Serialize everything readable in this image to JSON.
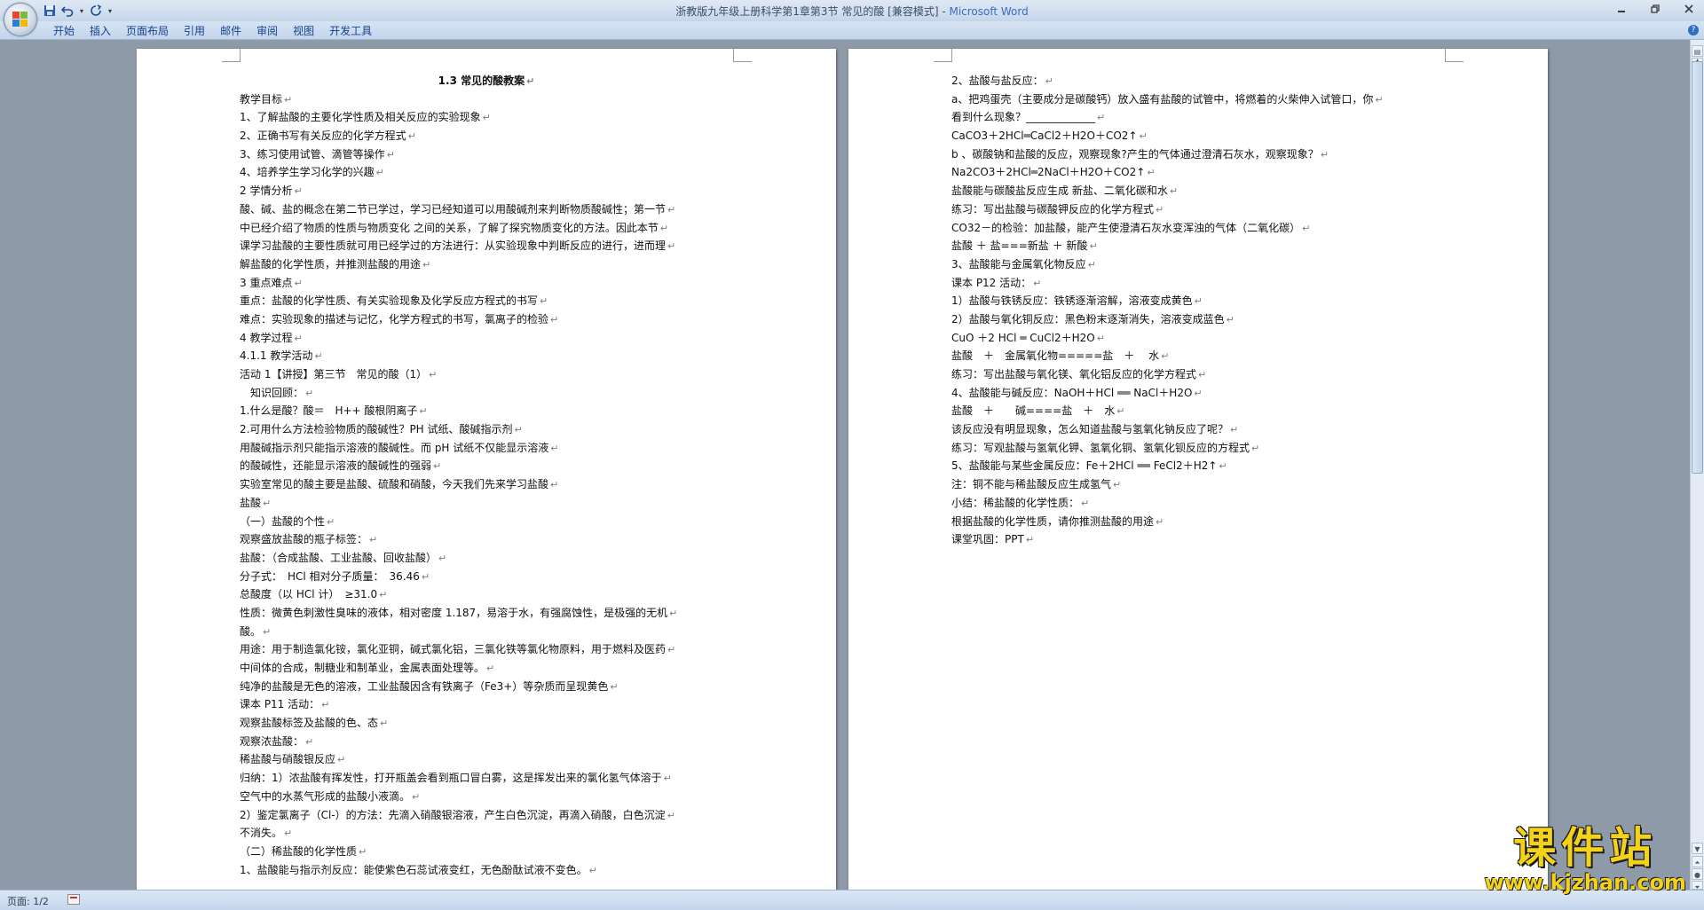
{
  "window": {
    "title_doc": "浙教版九年级上册科学第1章第3节 常见的酸 [兼容模式] - ",
    "title_app": "Microsoft Word"
  },
  "qat": {
    "more": "▾"
  },
  "ribbon": {
    "tabs": [
      "开始",
      "插入",
      "页面布局",
      "引用",
      "邮件",
      "审阅",
      "视图",
      "开发工具"
    ]
  },
  "page1": {
    "lines": [
      "1.3 常见的酸教案",
      "教学目标",
      "1、了解盐酸的主要化学性质及相关反应的实验现象",
      "2、正确书写有关反应的化学方程式",
      "3、练习使用试管、滴管等操作",
      "4、培养学生学习化学的兴趣",
      "2 学情分析",
      "酸、碱、盐的概念在第二节已学过，学习已经知道可以用酸碱剂来判断物质酸碱性；第一节",
      "中已经介绍了物质的性质与物质变化 之间的关系，了解了探究物质变化的方法。因此本节",
      "课学习盐酸的主要性质就可用已经学过的方法进行：从实验现象中判断反应的进行，进而理",
      "解盐酸的化学性质，并推测盐酸的用途",
      "3 重点难点",
      "重点：盐酸的化学性质、有关实验现象及化学反应方程式的书写",
      "难点：实验现象的描述与记忆，化学方程式的书写，氯离子的检验",
      "4 教学过程",
      "4.1.1 教学活动",
      "活动 1【讲授】第三节　常见的酸（1）",
      "　知识回顾：",
      "1.什么是酸？酸＝　H++ 酸根阴离子",
      "2.可用什么方法检验物质的酸碱性？PH 试纸、酸碱指示剂",
      "用酸碱指示剂只能指示溶液的酸碱性。而 pH 试纸不仅能显示溶液",
      "的酸碱性，还能显示溶液的酸碱性的强弱",
      "实验室常见的酸主要是盐酸、硫酸和硝酸，今天我们先来学习盐酸",
      "盐酸",
      "（一）盐酸的个性",
      "观察盛放盐酸的瓶子标签：",
      "盐酸：（合成盐酸、工业盐酸、回收盐酸）",
      "分子式：　HCl  相对分子质量：　36.46",
      "总酸度（以  HCl 计）　≥31.0",
      "性质：微黄色刺激性臭味的液体，相对密度  1.187，易溶于水，有强腐蚀性，是极强的无机",
      "酸。",
      "用途：用于制造氯化铵，氯化亚铜，碱式氯化铝，三氯化铁等氯化物原料，用于燃料及医药",
      "中间体的合成，制糖业和制革业，金属表面处理等。",
      "纯净的盐酸是无色的溶液，工业盐酸因含有铁离子（Fe3+）等杂质而呈现黄色",
      "课本 P11 活动：",
      "观察盐酸标签及盐酸的色、态",
      "观察浓盐酸：",
      "稀盐酸与硝酸银反应",
      "归纳：1）浓盐酸有挥发性，打开瓶盖会看到瓶口冒白雾，这是挥发出来的氯化氢气体溶于",
      "空气中的水蒸气形成的盐酸小液滴。",
      "2）鉴定氯离子（Cl-）的方法：先滴入硝酸银溶液，产生白色沉淀，再滴入硝酸，白色沉淀",
      "不消失。",
      "（二）稀盐酸的化学性质",
      "1、盐酸能与指示剂反应：能使紫色石蕊试液变红，无色酚酞试液不变色。"
    ]
  },
  "page2": {
    "lines": [
      "2、盐酸与盐反应：",
      "a、把鸡蛋壳（主要成分是碳酸钙）放入盛有盐酸的试管中，将燃着的火柴伸入试管口，你",
      "看到什么现象？_____________",
      "CaCO3＋2HCl═CaCl2＋H2O＋CO2↑",
      "b 、碳酸钠和盐酸的反应，观察现象?产生的气体通过澄清石灰水，观察现象？",
      "Na2CO3＋2HCl═2NaCl＋H2O＋CO2↑",
      "盐酸能与碳酸盐反应生成 新盐、二氧化碳和水",
      "练习：写出盐酸与碳酸钾反应的化学方程式",
      "CO32－的检验：加盐酸，能产生使澄清石灰水变浑浊的气体（二氧化碳）",
      "盐酸 ＋ 盐===新盐 ＋ 新酸",
      "3、盐酸能与金属氧化物反应",
      "课本 P12 活动：",
      "1）盐酸与铁锈反应：铁锈逐渐溶解，溶液变成黄色",
      "2）盐酸与氧化铜反应：黑色粉末逐渐消失，溶液变成蓝色",
      "CuO ＋2 HCl ═ CuCl2＋H2O",
      "盐酸　＋　金属氧化物=====盐　＋　 水",
      "练习：写出盐酸与氧化镁、氧化铝反应的化学方程式",
      "4、盐酸能与碱反应：NaOH＋HCl ══ NaCl＋H2O",
      "盐酸　＋　　碱====盐　＋　水",
      "该反应没有明显现象，怎么知道盐酸与氢氧化钠反应了呢？",
      "练习：写观盐酸与氢氧化钾、氢氧化铜、氢氧化钡反应的方程式",
      "5、盐酸能与某些金属反应：Fe＋2HCl ══ FeCl2＋H2↑",
      "注：铜不能与稀盐酸反应生成氢气",
      "小结：稀盐酸的化学性质：",
      "根据盐酸的化学性质，请你推测盐酸的用途",
      "课堂巩固：PPT"
    ]
  },
  "statusbar": {
    "page": "页面: 1/2"
  },
  "watermark": {
    "title": "课件站",
    "url": "www.kjzhan.com"
  },
  "paragraph_mark": "↵",
  "colors": {
    "ribbon": "#c3d5ec",
    "workspace": "#8f9aa9",
    "watermark": "#f4d21a",
    "app_title": "#3a6ec0"
  }
}
